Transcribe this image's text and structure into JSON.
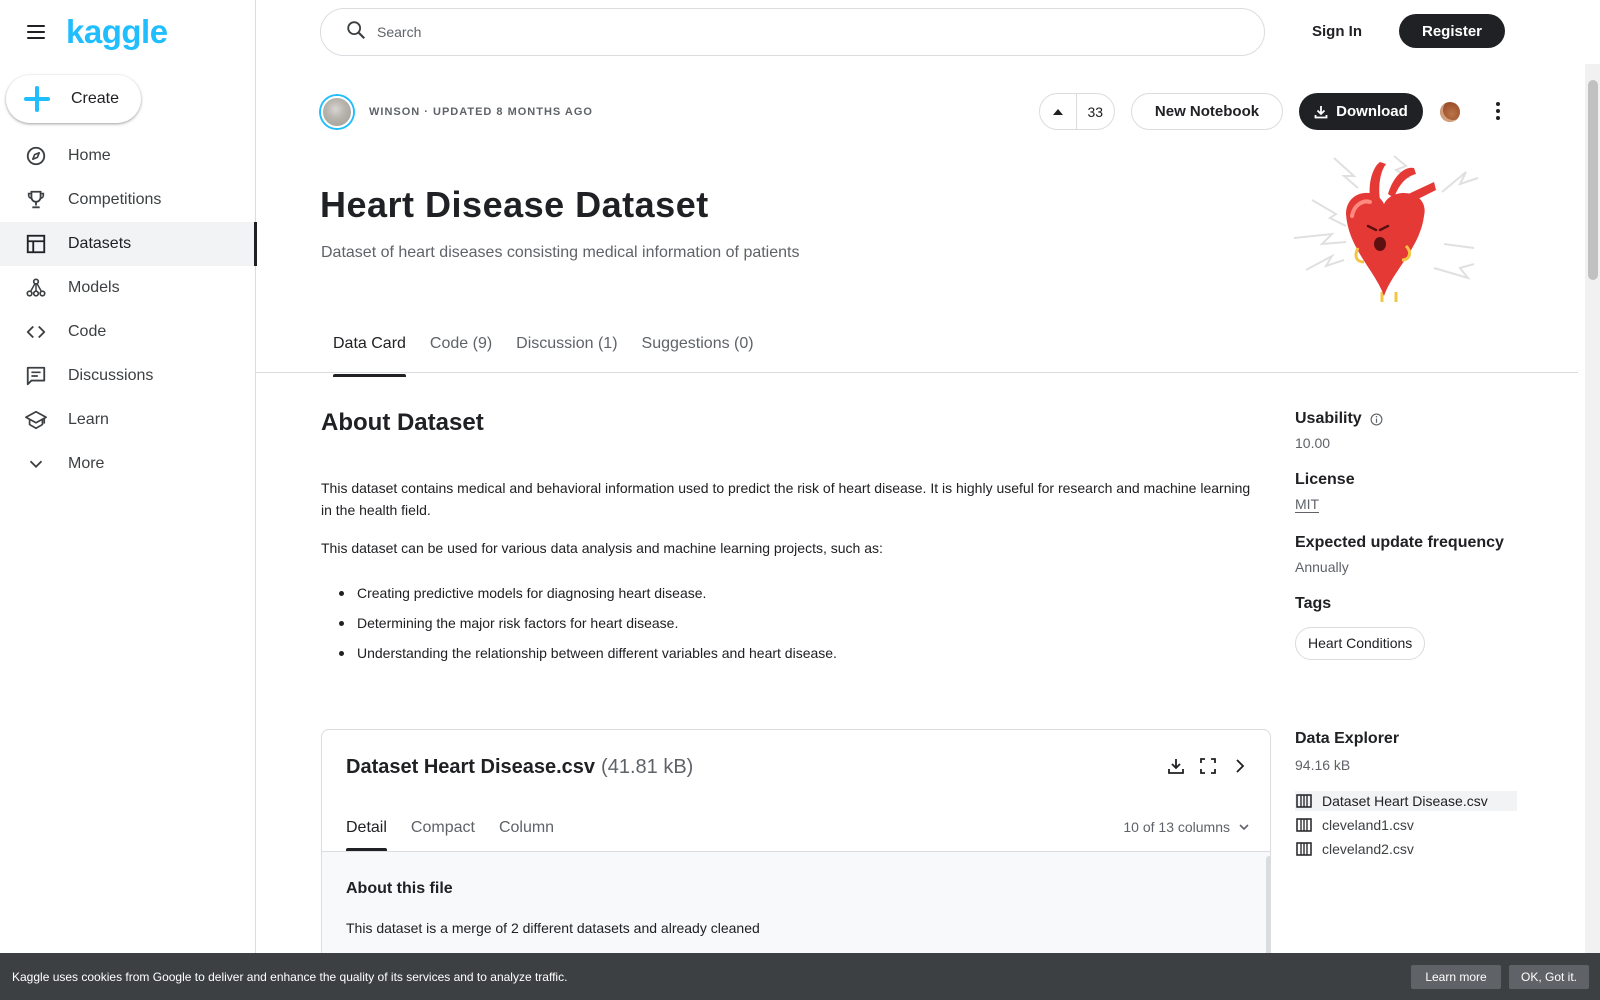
{
  "brand": {
    "logo_text": "kaggle",
    "accent": "#20beff",
    "dark": "#202124"
  },
  "sidebar": {
    "create_label": "Create",
    "items": [
      {
        "label": "Home",
        "icon": "compass-icon"
      },
      {
        "label": "Competitions",
        "icon": "trophy-icon"
      },
      {
        "label": "Datasets",
        "icon": "table-icon",
        "active": true
      },
      {
        "label": "Models",
        "icon": "models-icon"
      },
      {
        "label": "Code",
        "icon": "code-icon"
      },
      {
        "label": "Discussions",
        "icon": "comments-icon"
      },
      {
        "label": "Learn",
        "icon": "school-icon"
      },
      {
        "label": "More",
        "icon": "chevron-down-icon"
      }
    ]
  },
  "header": {
    "search_placeholder": "Search",
    "sign_in_label": "Sign In",
    "register_label": "Register"
  },
  "dataset": {
    "author_line": "WINSON · UPDATED 8 MONTHS AGO",
    "vote_count": "33",
    "new_notebook_label": "New Notebook",
    "download_label": "Download",
    "title": "Heart Disease Dataset",
    "subtitle": "Dataset of heart diseases consisting medical information of patients"
  },
  "tabs": [
    {
      "label": "Data Card",
      "active": true
    },
    {
      "label": "Code (9)"
    },
    {
      "label": "Discussion (1)"
    },
    {
      "label": "Suggestions (0)"
    }
  ],
  "about": {
    "heading": "About Dataset",
    "paragraph1": "This dataset contains medical and behavioral information used to predict the risk of heart disease. It is highly useful for research and machine learning in the health field.",
    "paragraph2": "This dataset can be used for various data analysis and machine learning projects, such as:",
    "bullets": [
      "Creating predictive models for diagnosing heart disease.",
      "Determining the major risk factors for heart disease.",
      "Understanding the relationship between different variables and heart disease."
    ]
  },
  "file_card": {
    "file_name": "Dataset Heart Disease.csv",
    "file_size": "(41.81 kB)",
    "tabs": [
      "Detail",
      "Compact",
      "Column"
    ],
    "columns_label": "10 of 13 columns",
    "about_heading": "About this file",
    "about_text": "This dataset is a merge of 2 different datasets and already cleaned"
  },
  "meta": {
    "usability_label": "Usability",
    "usability_value": "10.00",
    "license_label": "License",
    "license_value": "MIT",
    "update_label": "Expected update frequency",
    "update_value": "Annually",
    "tags_label": "Tags",
    "tags": [
      "Heart Conditions"
    ]
  },
  "explorer": {
    "heading": "Data Explorer",
    "size": "94.16 kB",
    "files": [
      {
        "name": "Dataset Heart Disease.csv",
        "active": true
      },
      {
        "name": "cleveland1.csv"
      },
      {
        "name": "cleveland2.csv"
      }
    ]
  },
  "cookie": {
    "text": "Kaggle uses cookies from Google to deliver and enhance the quality of its services and to analyze traffic.",
    "learn_more": "Learn more",
    "got_it": "OK, Got it."
  }
}
